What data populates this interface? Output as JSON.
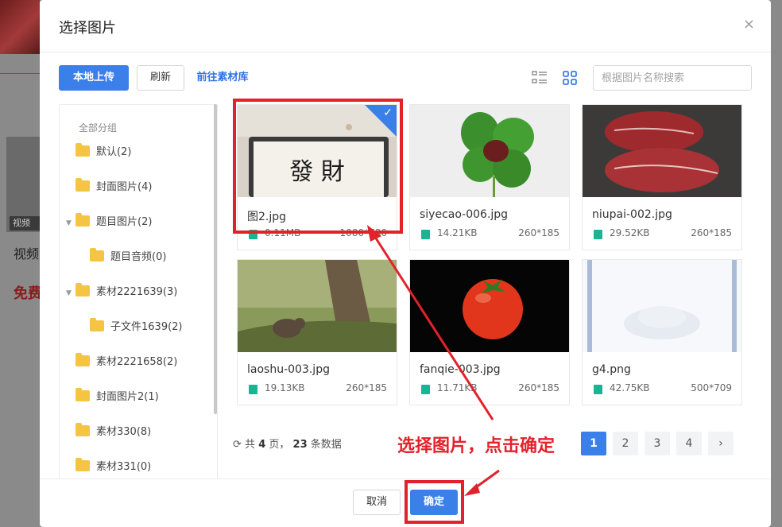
{
  "background": {
    "tag_text": "视频",
    "text_1": "视频",
    "text_2": "免费"
  },
  "dialog": {
    "title": "选择图片",
    "close_glyph": "×"
  },
  "toolbar": {
    "upload_label": "本地上传",
    "refresh_label": "刷新",
    "library_link": "前往素材库",
    "search_placeholder": "根据图片名称搜索"
  },
  "sidebar": {
    "header": "全部分组",
    "items": [
      {
        "label": "默认(2)"
      },
      {
        "label": "封面图片(4)"
      },
      {
        "label": "题目图片(2)"
      },
      {
        "label": "题目音频(0)"
      },
      {
        "label": "素材2221639(3)"
      },
      {
        "label": "子文件1639(2)"
      },
      {
        "label": "素材2221658(2)"
      },
      {
        "label": "封面图片2(1)"
      },
      {
        "label": "素材330(8)"
      },
      {
        "label": "素材331(0)"
      }
    ]
  },
  "images": [
    {
      "name": "图2.jpg",
      "size": "0.11MB",
      "dims": "1080*780",
      "selected": true
    },
    {
      "name": "siyecao-006.jpg",
      "size": "14.21KB",
      "dims": "260*185",
      "selected": false
    },
    {
      "name": "niupai-002.jpg",
      "size": "29.52KB",
      "dims": "260*185",
      "selected": false
    },
    {
      "name": "laoshu-003.jpg",
      "size": "19.13KB",
      "dims": "260*185",
      "selected": false
    },
    {
      "name": "fanqie-003.jpg",
      "size": "11.71KB",
      "dims": "260*185",
      "selected": false
    },
    {
      "name": "g4.png",
      "size": "42.75KB",
      "dims": "500*709",
      "selected": false
    }
  ],
  "photo_text": "發 財",
  "pagination": {
    "prefix": "共",
    "pages": "4",
    "pages_unit": "页，",
    "total": "23",
    "total_unit": "条数据",
    "buttons": [
      "1",
      "2",
      "3",
      "4"
    ],
    "next_glyph": "›",
    "current": "1"
  },
  "footer": {
    "cancel_label": "取消",
    "confirm_label": "确定"
  },
  "annotation": {
    "text": "选择图片，点击确定",
    "color": "#e1222b"
  },
  "colors": {
    "primary": "#3b7fe9",
    "folder": "#f6c443",
    "image_icon": "#1ab394"
  }
}
